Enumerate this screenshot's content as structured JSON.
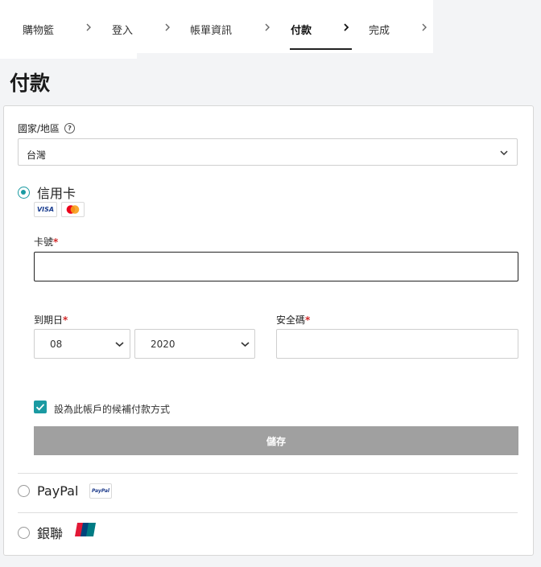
{
  "stepper": {
    "steps": [
      {
        "label": "購物籃"
      },
      {
        "label": "登入"
      },
      {
        "label": "帳單資訊"
      },
      {
        "label": "付款"
      },
      {
        "label": "完成"
      }
    ],
    "active_step": "付款"
  },
  "page": {
    "title": "付款"
  },
  "country": {
    "label": "國家/地區",
    "value": "台灣"
  },
  "payment_methods": {
    "credit_card": {
      "label": "信用卡",
      "selected": true,
      "brands": [
        "VISA",
        "Mastercard"
      ]
    },
    "paypal": {
      "label": "PayPal",
      "selected": false,
      "badge": "PayPal"
    },
    "unionpay": {
      "label": "銀聯",
      "selected": false
    }
  },
  "card_form": {
    "card_number_label": "卡號",
    "card_number_value": "",
    "expiry_label": "到期日",
    "expiry_month": "08",
    "expiry_year": "2020",
    "cvv_label": "安全碼",
    "cvv_value": "",
    "required_mark": "*",
    "default_checkbox_label": "設為此帳戶的候補付款方式",
    "default_checked": true,
    "save_label": "儲存"
  },
  "colors": {
    "accent": "#1a9aa2",
    "required": "#d12a2a",
    "disabled_button": "#a0a0a0",
    "background": "#f3f4f6"
  }
}
